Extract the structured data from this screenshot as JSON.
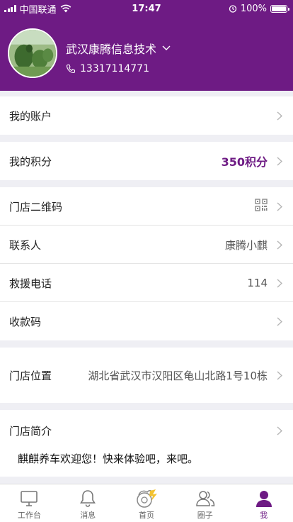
{
  "status_bar": {
    "carrier": "中国联通",
    "time": "17:47",
    "battery": "100%"
  },
  "profile": {
    "shop_name": "武汉康腾信息技术",
    "phone": "13317114771"
  },
  "rows": {
    "account": {
      "label": "我的账户"
    },
    "points": {
      "label": "我的积分",
      "value": "350积分"
    },
    "qrcode": {
      "label": "门店二维码"
    },
    "contact": {
      "label": "联系人",
      "value": "康腾小麒"
    },
    "rescue": {
      "label": "救援电话",
      "value": "114"
    },
    "payment_code": {
      "label": "收款码"
    },
    "location": {
      "label": "门店位置",
      "value": "湖北省武汉市汉阳区龟山北路1号10栋"
    },
    "intro": {
      "label": "门店简介",
      "text": "麒麒养车欢迎您！快来体验吧，来吧。"
    }
  },
  "tabbar": {
    "workbench": "工作台",
    "messages": "消息",
    "home": "首页",
    "circle": "圈子",
    "me": "我"
  },
  "colors": {
    "brand": "#6e1b84",
    "background": "#efeff4"
  }
}
